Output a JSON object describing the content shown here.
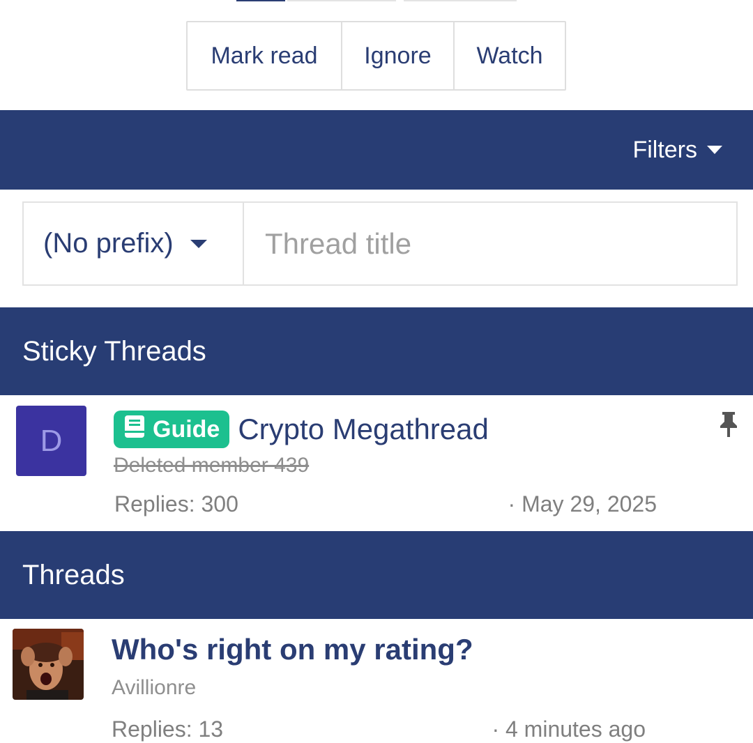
{
  "actions": {
    "mark_read": "Mark read",
    "ignore": "Ignore",
    "watch": "Watch"
  },
  "filters": {
    "label": "Filters"
  },
  "new_thread": {
    "prefix_selected": "(No prefix)",
    "title_placeholder": "Thread title"
  },
  "sticky_section": {
    "heading": "Sticky Threads",
    "threads": [
      {
        "avatar_letter": "D",
        "prefix": "Guide",
        "title": "Crypto Megathread",
        "author": "Deleted member 439",
        "replies": "Replies: 300",
        "date": "· May 29, 2025",
        "icons": [
          "book-icon",
          "pin-icon"
        ]
      }
    ]
  },
  "threads_section": {
    "heading": "Threads",
    "threads": [
      {
        "title": "Who's right on my rating?",
        "author": "Avillionre",
        "replies": "Replies: 13",
        "date": "· 4 minutes ago"
      }
    ]
  },
  "colors": {
    "nav_blue": "#283d74",
    "link_blue": "#2a3d73",
    "guide_green": "#1cc08f",
    "avatar_purple": "#3b33a0",
    "muted_gray": "#8e8e8e"
  }
}
